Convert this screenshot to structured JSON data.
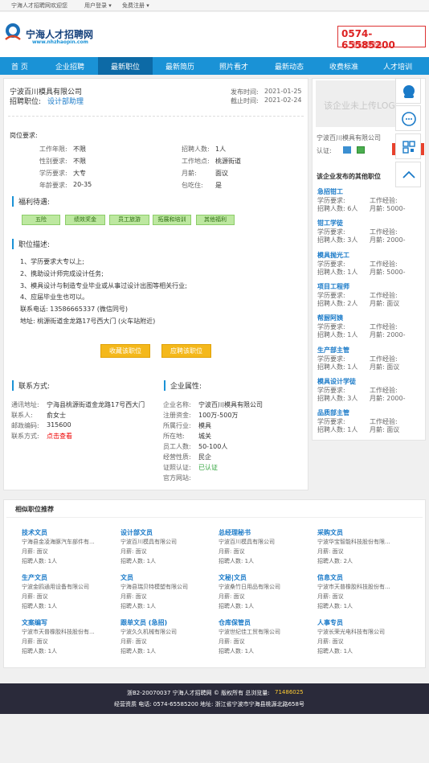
{
  "topbar": {
    "welcome": "宁海人才招聘网欢迎您",
    "user_login": "用户登录",
    "free_register": "免费注册"
  },
  "header": {
    "logo_cn": "宁海人才招聘网",
    "logo_en": "www.nhzhaopin.com",
    "hotline": "0574-65585200",
    "hotline_sub": "官方客服热线"
  },
  "nav": [
    "首 页",
    "企业招聘",
    "最新职位",
    "最新简历",
    "照片看才",
    "最新动态",
    "收费标准",
    "人才培训"
  ],
  "job": {
    "company": "宁波百川模具有限公司",
    "position_label": "招聘职位:",
    "position": "设计部助理",
    "publish_label": "发布时间:",
    "publish": "2021-01-25",
    "deadline_label": "截止时间:",
    "deadline": "2021-02-24",
    "req_title": "岗位要求:",
    "req": [
      [
        "工作年限:",
        "不限",
        "招聘人数:",
        "1人"
      ],
      [
        "性别要求:",
        "不限",
        "工作地点:",
        "桃源街道"
      ],
      [
        "学历要求:",
        "大专",
        "月薪:",
        "面议"
      ],
      [
        "年龄要求:",
        "20-35",
        "包吃住:",
        "是"
      ]
    ],
    "welfare_title": "福利待遇:",
    "welfare": [
      "五险",
      "绩效奖金",
      "员工旅游",
      "拓展和培训",
      "其他福利"
    ],
    "desc_title": "职位描述:",
    "desc": [
      "1、学历要求大专以上;",
      "2、携助设计师完成设计任务;",
      "3、模具设计与制造专业毕业或从事过设计出图等相关行业;",
      "4、应届毕业生也可以。"
    ],
    "phone": "联系电话: 13586665337 (微信同号)",
    "address": "地址: 桃源街道金龙路17号西大门 (火车站附近)",
    "btn_fav": "收藏该职位",
    "btn_apply": "应聘该职位"
  },
  "contact": {
    "title": "联系方式:",
    "rows": [
      [
        "通讯地址:",
        "宁海县桃源街道金龙路17号西大门"
      ],
      [
        "联系人:",
        "俞女士"
      ],
      [
        "邮政编码:",
        "315600"
      ],
      [
        "联系方式:",
        "点击查看"
      ]
    ]
  },
  "company_attr": {
    "title": "企业属性:",
    "rows": [
      [
        "企业名称:",
        "宁波百川模具有限公司"
      ],
      [
        "注册资金:",
        "100万-500万"
      ],
      [
        "所属行业:",
        "模具"
      ],
      [
        "所在地:",
        "城关"
      ],
      [
        "员工人数:",
        "50-100人"
      ],
      [
        "经营性质:",
        "民企"
      ],
      [
        "证照认证:",
        "已认证"
      ],
      [
        "官方网站:",
        ""
      ]
    ]
  },
  "side": {
    "placeholder": "该企业未上传LOGO",
    "company": "宁波百川模具有限公司",
    "cert": "认证:",
    "other_title": "该企业发布的其他职位"
  },
  "other_jobs": [
    {
      "title": "急招钳工",
      "edu": "学历要求:",
      "exp": "工作经验:",
      "num": "招聘人数: 6人",
      "pay": "月薪: 5000-"
    },
    {
      "title": "钳工学徒",
      "edu": "学历要求:",
      "exp": "工作经验:",
      "num": "招聘人数: 3人",
      "pay": "月薪: 2000-"
    },
    {
      "title": "模具抛光工",
      "edu": "学历要求:",
      "exp": "工作经验:",
      "num": "招聘人数: 1人",
      "pay": "月薪: 5000-"
    },
    {
      "title": "项目工程师",
      "edu": "学历要求:",
      "exp": "工作经验:",
      "num": "招聘人数: 2人",
      "pay": "月薪: 面议"
    },
    {
      "title": "帮厨阿姨",
      "edu": "学历要求:",
      "exp": "工作经验:",
      "num": "招聘人数: 1人",
      "pay": "月薪: 2000-"
    },
    {
      "title": "生产部主管",
      "edu": "学历要求:",
      "exp": "工作经验:",
      "num": "招聘人数: 1人",
      "pay": "月薪: 面议"
    },
    {
      "title": "模具设计学徒",
      "edu": "学历要求:",
      "exp": "工作经验:",
      "num": "招聘人数: 3人",
      "pay": "月薪: 2000-"
    },
    {
      "title": "品质部主管",
      "edu": "学历要求:",
      "exp": "工作经验:",
      "num": "招聘人数: 1人",
      "pay": "月薪: 面议"
    }
  ],
  "related_title": "相似职位推荐",
  "related": [
    {
      "t": "技术文员",
      "c": "宁海县金凌海豚汽车部件有...",
      "p": "月薪: 面议",
      "n": "招聘人数: 1人"
    },
    {
      "t": "设计部文员",
      "c": "宁波百川模具有限公司",
      "p": "月薪: 面议",
      "n": "招聘人数: 1人"
    },
    {
      "t": "总经理秘书",
      "c": "宁波百川模具有限公司",
      "p": "月薪: 面议",
      "n": "招聘人数: 1人"
    },
    {
      "t": "采购文员",
      "c": "宁波华宝智能科技股份有限...",
      "p": "月薪: 面议",
      "n": "招聘人数: 2人"
    },
    {
      "t": "生产文员",
      "c": "宁波金鸥通用设备有限公司",
      "p": "月薪: 面议",
      "n": "招聘人数: 1人"
    },
    {
      "t": "文员",
      "c": "宁海县瑞贝特模塑有限公司",
      "p": "月薪: 面议",
      "n": "招聘人数: 1人"
    },
    {
      "t": "文秘|文员",
      "c": "宁波桑竹日用品有限公司",
      "p": "月薪: 面议",
      "n": "招聘人数: 1人"
    },
    {
      "t": "信息文员",
      "c": "宁波市天普橡胶科技股份有...",
      "p": "月薪: 面议",
      "n": "招聘人数: 1人"
    },
    {
      "t": "文案编写",
      "c": "宁波市天普橡胶科技股份有...",
      "p": "月薪: 面议",
      "n": "招聘人数: 1人"
    },
    {
      "t": "跟单文员 (急招)",
      "c": "宁波久久机械有限公司",
      "p": "月薪: 面议",
      "n": "招聘人数: 1人"
    },
    {
      "t": "仓库保管员",
      "c": "宁波世纪佳工贸有限公司",
      "p": "月薪: 面议",
      "n": "招聘人数: 1人"
    },
    {
      "t": "人事专员",
      "c": "宁波长荣光电科技有限公司",
      "p": "月薪: 面议",
      "n": "招聘人数: 1人"
    }
  ],
  "footer": {
    "line1a": "浙B2-20070037 宁海人才招聘网 © 版权所有 总浏览量:",
    "count": "71486025",
    "line2": "经营资质 电话: 0574-65585200 地址: 浙江省宁波市宁海县桃源北路658号"
  },
  "colors": {
    "nav": "#1a92d6",
    "nav_active": "#0d6aa6",
    "link": "#1a7ac8",
    "button": "#f4b81b",
    "welfare": "#bde8a0"
  }
}
